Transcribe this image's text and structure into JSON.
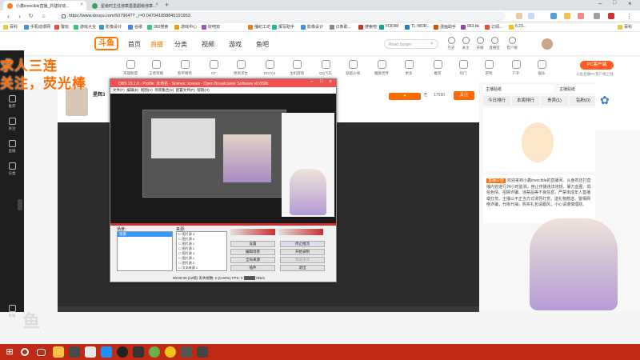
{
  "browser": {
    "tabs": [
      {
        "title": "小鑫invecible直播_共建好动..."
      },
      {
        "title": "星级时主任违章墨墨超级违章..."
      }
    ],
    "url": "https://www.douyu.com/507964?? _r=0.047041898845191953",
    "bookmarks": [
      "百科",
      "手机动漫网",
      "警玩",
      "游戏大全",
      "影像设计",
      "谷歌",
      "360搜索",
      "游戏中心",
      "好吧双",
      "播纪工坊",
      "报写助手",
      "影像设计",
      "(2条助...",
      "搜索吧",
      "FODIM",
      "TL-WDR...",
      "漫画助手",
      "063.bk",
      "订阅...",
      "6.23...",
      "百科"
    ]
  },
  "douyu": {
    "logo_text": "斗鱼",
    "nav": [
      "首页",
      "直播",
      "分类",
      "视频",
      "游戏",
      "鱼吧"
    ],
    "search_placeholder": "Road Surger",
    "header_icons": [
      "历史",
      "关注",
      "开播",
      "直播室",
      "客户端",
      "登录"
    ],
    "categories": [
      "英雄联盟",
      "王者荣耀",
      "和平精英",
      "CF",
      "绝地求生",
      "DOTA2",
      "主机游戏",
      "QQ飞车",
      "穿越火线",
      "魔兽世界",
      "更多",
      "推荐",
      "热门",
      "游戏",
      "户外",
      "娱乐",
      "科技",
      "更多"
    ],
    "pc_button": "PC客户端",
    "pc_subtitle": "斗鱼直播PC客户端上线",
    "left_sidebar": [
      "推荐",
      "关注",
      "直播",
      "分类",
      "赛事",
      "客服"
    ],
    "overlay_line1": "求人三连",
    "overlay_line2": "关注，荧光棒",
    "room_follow": "关注",
    "room_fans": "17590",
    "notice_tag": "直播公告",
    "notice_text": "欢迎来到小鑫invecible的直播间。从鱼农还打直播内容进行24小时监测，禁止传播违法违规、暴力血腥、低俗色情、招嫖诈骗、违禁品等不良信息，严禁未成年人直播或打赏。主播以不正当方式诱导打赏、送礼物赠送、警惕网络诈骗，代练代抽，购买礼包请跟风，小心请谨慎理财。",
    "right_tabs": [
      "今日排行",
      "本周排行",
      "贵宾(1)",
      "钻粉(0)"
    ],
    "right_buttons": [
      "主播贴纸",
      "主播贴纸"
    ],
    "room_tags": [
      "星辉3",
      "V",
      "1"
    ]
  },
  "obs": {
    "title": "OBS 23.1.0 - Profile: 未命名 - Scenes: scenes - Open Broadcaster Software v0.659b",
    "menu": [
      "文件(F)",
      "编辑(E)",
      "视图(V)",
      "场景集合(S)",
      "配置文件(P)",
      "帮助(H)"
    ],
    "scenes_label": "场景:",
    "sources_label": "来源:",
    "scene_items": [
      "场景"
    ],
    "source_items": [
      "图片源 3",
      "图片源 4",
      "图片源 1",
      "图片源 2",
      "图片源 3",
      "图片源 1",
      "图片源 2",
      "文本来源 1"
    ],
    "buttons": [
      "设置",
      "停止推流",
      "编辑场景",
      "开始录制",
      "全局来源",
      "预览串流",
      "插件",
      "退出"
    ],
    "status": "00:00:00 (12帧)    丢失帧数: 0 (0.00%)    FPS: 0    ",
    "status_rate": "0kb/s"
  },
  "taskbar": {
    "items": [
      "start",
      "search",
      "taskview",
      "explorer",
      "edge",
      "obs",
      "chrome",
      "notepad",
      "player",
      "app"
    ]
  }
}
